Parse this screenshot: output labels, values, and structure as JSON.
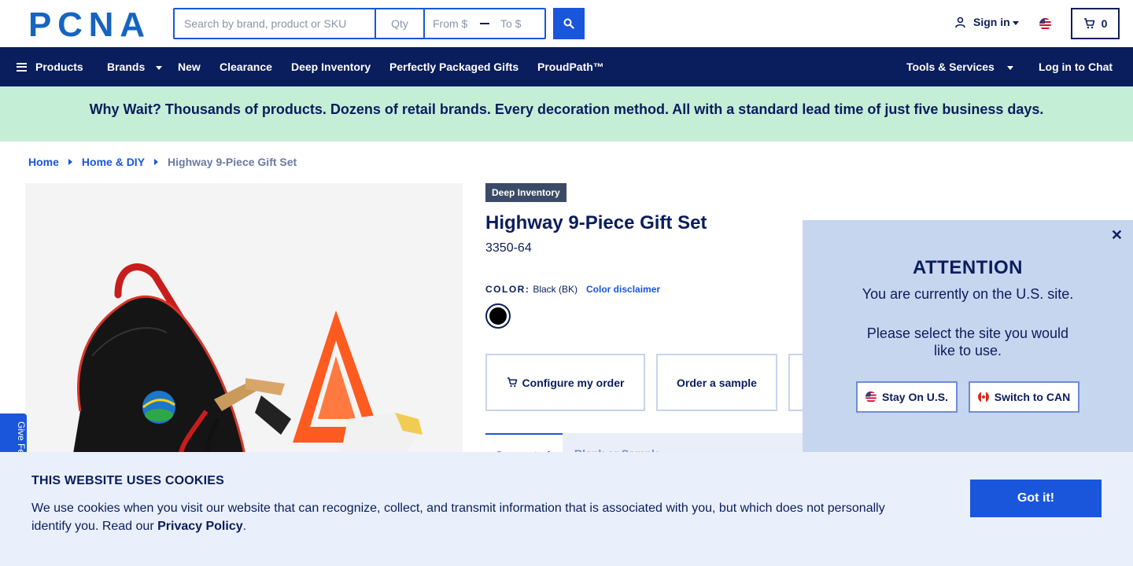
{
  "header": {
    "logo_text": "PCNA",
    "search_placeholder": "Search by brand, product or SKU",
    "qty_placeholder": "Qty",
    "price_from_placeholder": "From $",
    "price_to_placeholder": "To $",
    "sign_in_label": "Sign in",
    "cart_count": "0"
  },
  "nav": {
    "products": "Products",
    "brands": "Brands",
    "new": "New",
    "clearance": "Clearance",
    "deep_inventory": "Deep Inventory",
    "perfectly_packaged_gifts": "Perfectly Packaged Gifts",
    "proudpath": "ProudPath™",
    "tools_services": "Tools & Services",
    "log_in_chat": "Log in to Chat"
  },
  "banner": {
    "text": "Why Wait? Thousands of products. Dozens of retail brands. Every decoration method. All with a standard lead time of just five business days."
  },
  "breadcrumb": {
    "home": "Home",
    "category": "Home & DIY",
    "current": "Highway 9-Piece Gift Set"
  },
  "product": {
    "badge": "Deep Inventory",
    "title": "Highway 9-Piece Gift Set",
    "sku": "3350-64",
    "color_label": "COLOR:",
    "color_value": "Black (BK)",
    "color_disclaimer": "Color disclaimer",
    "swatch_color": "#000000",
    "configure_label": "Configure my order",
    "sample_label": "Order a sample",
    "tab_active": "Decorated",
    "tab_inactive": "Blank or Sample"
  },
  "feedback": {
    "label": "Give Feedback"
  },
  "modal": {
    "close": "✕",
    "title": "ATTENTION",
    "line1": "You are currently on the U.S. site.",
    "line2": "Please select the site you would like to use.",
    "stay_label": "Stay On U.S.",
    "switch_label": "Switch to CAN"
  },
  "cookie": {
    "title": "THIS WEBSITE USES COOKIES",
    "text_before": "We use cookies when you visit our website that can recognize, collect, and transmit information that is associated with you, but which does not personally identify you. Read our ",
    "privacy_link": "Privacy Policy",
    "text_after": ".",
    "got_it": "Got it!"
  },
  "colors": {
    "navy": "#0a1d5c",
    "accent": "#1a56db",
    "banner_green": "#c5eed6",
    "modal_bg": "#c7d6ef",
    "cookie_bg": "#eaf0fb"
  },
  "icons": {
    "search": "search-icon",
    "user": "user-icon",
    "cart": "cart-icon",
    "menu": "hamburger-icon",
    "flag_us": "us-flag-icon",
    "flag_ca": "canada-flag-icon"
  }
}
